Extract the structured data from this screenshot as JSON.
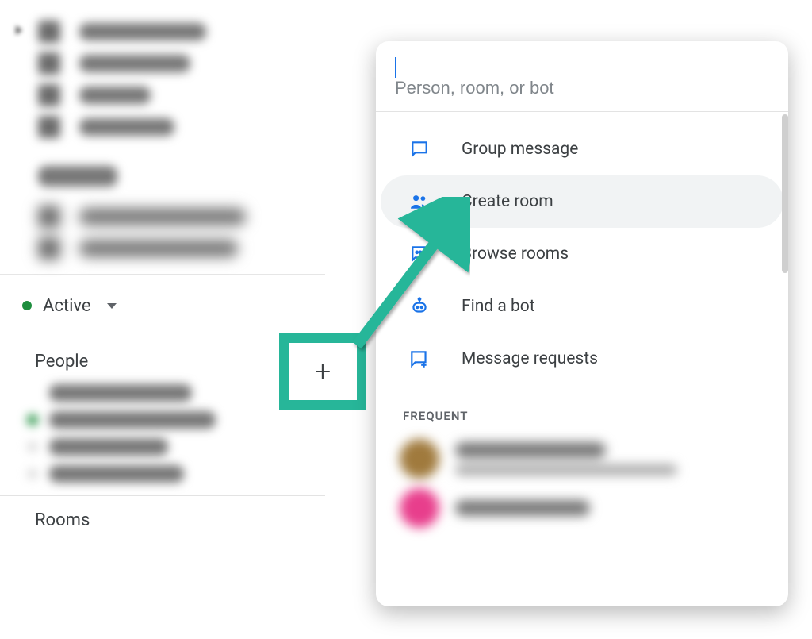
{
  "status": {
    "label": "Active",
    "state_color": "#1e8e3e"
  },
  "sections": {
    "people": "People",
    "rooms": "Rooms"
  },
  "search": {
    "placeholder": "Person, room, or bot"
  },
  "menu": {
    "group_message": "Group message",
    "create_room": "Create room",
    "browse_rooms": "Browse rooms",
    "find_bot": "Find a bot",
    "message_requests": "Message requests"
  },
  "frequent_label": "FREQUENT",
  "annotation": {
    "color": "#27b699"
  }
}
